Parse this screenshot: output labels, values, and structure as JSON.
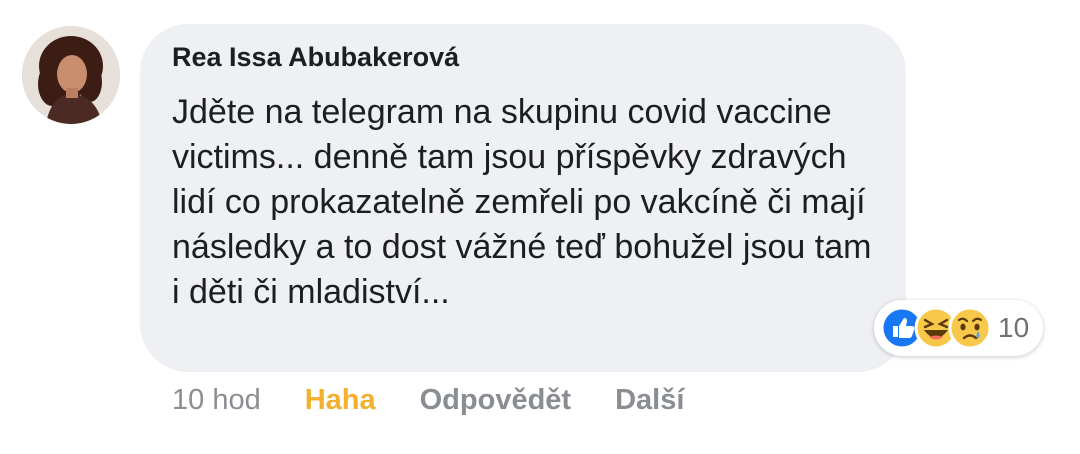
{
  "comment": {
    "author": "Rea Issa Abubakerová",
    "text": "Jděte na telegram na skupinu covid vaccine victims... denně tam jsou příspěvky zdravých lidí co prokazatelně zemřeli po vakcíně či mají následky a to dost vážné teď bohužel jsou tam i děti či mladiství...",
    "reactions": {
      "icons": [
        "like-icon",
        "haha-icon",
        "sad-icon"
      ],
      "count": "10"
    },
    "actions": {
      "timestamp": "10 hod",
      "haha_label": "Haha",
      "reply_label": "Odpovědět",
      "more_label": "Další"
    }
  },
  "colors": {
    "bubble": "#eff0f4",
    "text": "#1c1e21",
    "muted": "#8a8d91",
    "haha_active": "#f2b02e",
    "like_blue": "#1877f2",
    "emoji_yellow": "#f7c84a"
  }
}
